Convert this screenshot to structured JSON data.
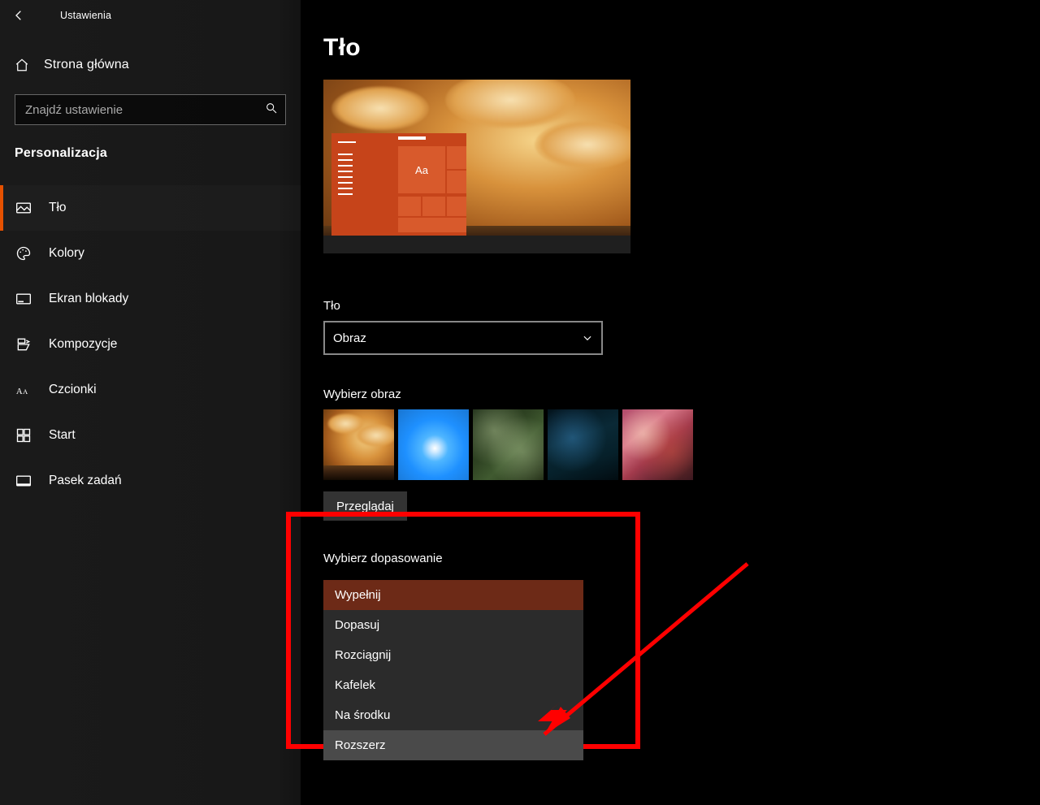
{
  "window": {
    "title": "Ustawienia"
  },
  "home_label": "Strona główna",
  "search_placeholder": "Znajdź ustawienie",
  "section": "Personalizacja",
  "nav": [
    {
      "label": "Tło"
    },
    {
      "label": "Kolory"
    },
    {
      "label": "Ekran blokady"
    },
    {
      "label": "Kompozycje"
    },
    {
      "label": "Czcionki"
    },
    {
      "label": "Start"
    },
    {
      "label": "Pasek zadań"
    }
  ],
  "page": {
    "title": "Tło",
    "preview_sample_text": "Aa",
    "bg_label": "Tło",
    "bg_dropdown_value": "Obraz",
    "choose_image_label": "Wybierz obraz",
    "browse_button": "Przeglądaj",
    "fit_label": "Wybierz dopasowanie",
    "fit_options": [
      "Wypełnij",
      "Dopasuj",
      "Rozciągnij",
      "Kafelek",
      "Na środku",
      "Rozszerz"
    ]
  }
}
